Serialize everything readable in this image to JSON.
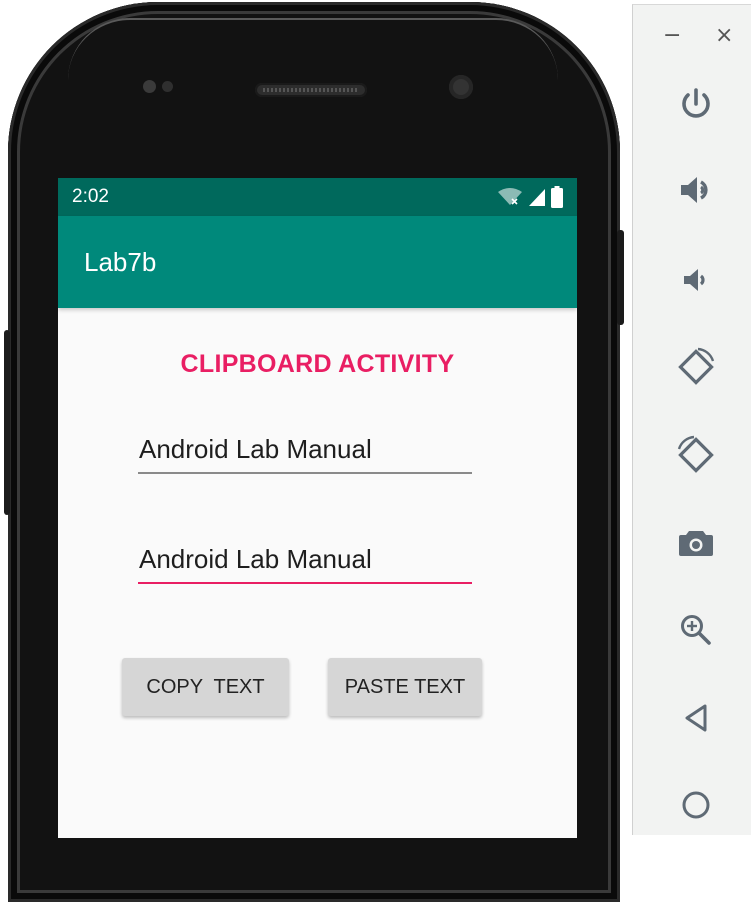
{
  "status_bar": {
    "time": "2:02",
    "icons": [
      "wifi-icon",
      "cellular-signal-icon",
      "battery-icon"
    ]
  },
  "app_bar": {
    "title": "Lab7b"
  },
  "main": {
    "heading": "CLIPBOARD ACTIVITY",
    "source_field": {
      "value": "Android Lab Manual"
    },
    "destination_field": {
      "value": "Android Lab Manual"
    },
    "copy_button": "COPY  TEXT",
    "paste_button": "PASTE TEXT"
  },
  "emulator_panel": {
    "minimize": "−",
    "close": "×",
    "tools": [
      "power-icon",
      "volume-up-icon",
      "volume-down-icon",
      "rotate-left-icon",
      "rotate-right-icon",
      "camera-icon",
      "zoom-icon",
      "back-icon",
      "home-icon"
    ]
  },
  "colors": {
    "status_bar": "#00695c",
    "app_bar": "#00897b",
    "accent": "#e91e63",
    "panel_icon": "#5f6a75"
  }
}
